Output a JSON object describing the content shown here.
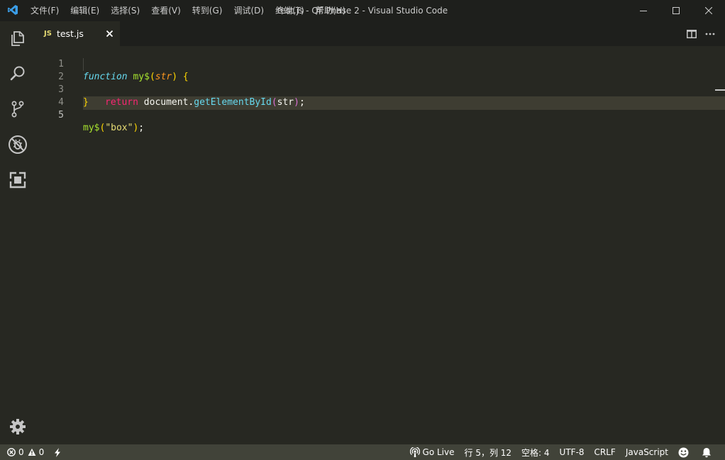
{
  "window": {
    "title": "test.js - QF Phase 2 - Visual Studio Code",
    "menu": [
      "文件(F)",
      "编辑(E)",
      "选择(S)",
      "查看(V)",
      "转到(G)",
      "调试(D)",
      "终端(T)",
      "帮助(H)"
    ]
  },
  "activity_bar": {
    "items": [
      "explorer-icon",
      "search-icon",
      "source-control-icon",
      "debug-icon",
      "extensions-icon"
    ],
    "bottom": "gear-icon"
  },
  "tab": {
    "badge": "JS",
    "label": "test.js",
    "close": "×"
  },
  "editor": {
    "line_numbers": [
      "1",
      "2",
      "3",
      "4",
      "5"
    ],
    "active_line": 5,
    "code": {
      "l1_kw": "function",
      "l1_name": "my$",
      "l1_open": "(",
      "l1_param": "str",
      "l1_close": ")",
      "l1_brace": "{",
      "l2_ret": "return",
      "l2_obj": "document",
      "l2_dot": ".",
      "l2_fn": "getElementById",
      "l2_open": "(",
      "l2_arg": "str",
      "l2_close": ")",
      "l2_semi": ";",
      "l3_brace": "}",
      "l5_fn": "my$",
      "l5_open": "(",
      "l5_str": "\"box\"",
      "l5_close": ")",
      "l5_semi": ";"
    }
  },
  "status_bar": {
    "errors": "0",
    "warnings": "0",
    "go_live": "Go Live",
    "position": "行 5，列 12",
    "spaces": "空格: 4",
    "encoding": "UTF-8",
    "eol": "CRLF",
    "language": "JavaScript"
  },
  "colors": {
    "editor_bg": "#272822",
    "titlebar_bg": "#1e1f1c",
    "statusbar_bg": "#414339",
    "current_line_bg": "#3e3d32"
  }
}
